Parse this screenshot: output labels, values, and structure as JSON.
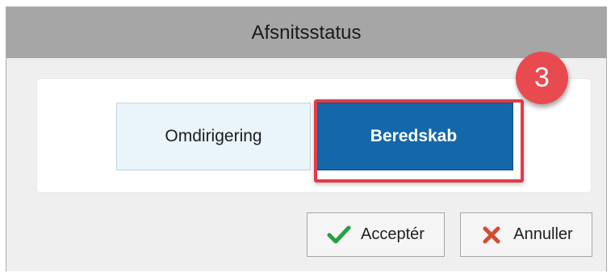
{
  "dialog": {
    "title": "Afsnitsstatus"
  },
  "status_toggle": {
    "left_label": "Omdirigering",
    "right_label": "Beredskab",
    "selected": "Beredskab"
  },
  "annotation": {
    "step_number": "3",
    "highlight_color": "#e23b47"
  },
  "actions": {
    "accept_label": "Acceptér",
    "cancel_label": "Annuller",
    "accept_icon": "check-icon",
    "cancel_icon": "close-icon"
  },
  "colors": {
    "title_bar": "#a6a6a6",
    "dialog_background": "#efefef",
    "selected_toggle": "#1467a9",
    "unselected_toggle": "#e9f4fb",
    "check": "#27a045",
    "cancel": "#d34b35"
  }
}
